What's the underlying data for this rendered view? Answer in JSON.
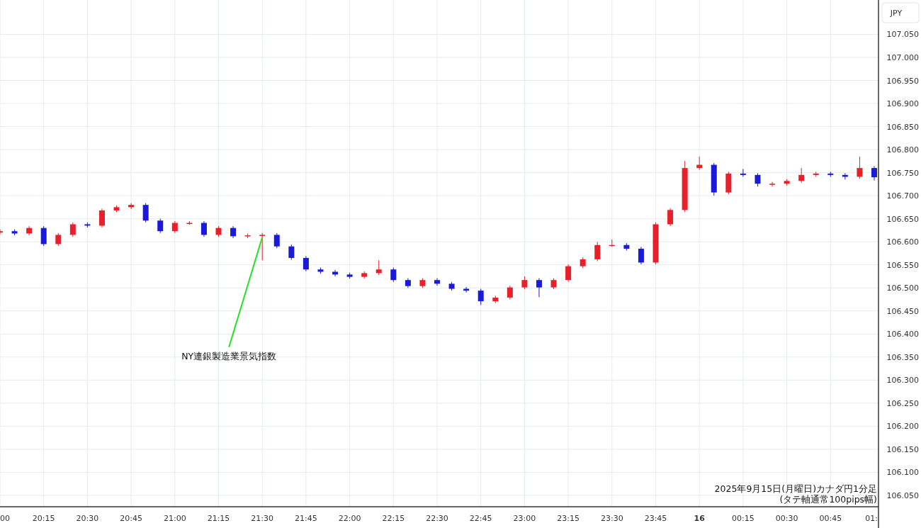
{
  "chart": {
    "unit": "JPY",
    "edge_label": "01:",
    "caption": [
      "2025年9月15日(月曜日)カナダ円1分足",
      "(タテ軸通常100pips幅)"
    ],
    "chart_data": {
      "type": "candlestick",
      "categories": [
        "00",
        null,
        null,
        "20:15",
        null,
        null,
        "20:30",
        null,
        null,
        "20:45",
        null,
        null,
        "21:00",
        null,
        null,
        "21:15",
        null,
        null,
        "21:30",
        null,
        null,
        "21:45",
        null,
        null,
        "22:00",
        null,
        null,
        "22:15",
        null,
        null,
        "22:30",
        null,
        null,
        "22:45",
        null,
        null,
        "23:00",
        null,
        null,
        "23:15",
        null,
        null,
        "23:30",
        null,
        null,
        "23:45",
        null,
        null,
        "16",
        null,
        null,
        "00:15",
        null,
        null,
        "00:30",
        null,
        null,
        "00:45",
        null,
        null,
        null
      ],
      "ohlc": [
        [
          106.62,
          106.627,
          106.616,
          106.623
        ],
        [
          106.623,
          106.627,
          106.614,
          106.618
        ],
        [
          106.618,
          106.634,
          106.614,
          106.63
        ],
        [
          106.63,
          106.634,
          106.591,
          106.595
        ],
        [
          106.595,
          106.619,
          106.591,
          106.615
        ],
        [
          106.615,
          106.642,
          106.611,
          106.638
        ],
        [
          106.638,
          106.642,
          106.631,
          106.635
        ],
        [
          106.635,
          106.672,
          106.631,
          106.668
        ],
        [
          106.668,
          106.679,
          106.664,
          106.675
        ],
        [
          106.675,
          106.684,
          106.671,
          106.68
        ],
        [
          106.68,
          106.684,
          106.642,
          106.646
        ],
        [
          106.646,
          106.65,
          106.619,
          106.623
        ],
        [
          106.623,
          106.645,
          106.619,
          106.641
        ],
        [
          106.641,
          106.645,
          106.637,
          106.641
        ],
        [
          106.641,
          106.645,
          106.611,
          106.615
        ],
        [
          106.615,
          106.634,
          106.611,
          106.63
        ],
        [
          106.63,
          106.634,
          106.608,
          106.612
        ],
        [
          106.612,
          106.618,
          106.608,
          106.614
        ],
        [
          106.614,
          106.619,
          106.56,
          106.615
        ],
        [
          106.615,
          106.619,
          106.586,
          106.59
        ],
        [
          106.59,
          106.594,
          106.561,
          106.565
        ],
        [
          106.565,
          106.569,
          106.536,
          106.54
        ],
        [
          106.54,
          106.544,
          106.531,
          106.535
        ],
        [
          106.535,
          106.539,
          106.525,
          106.529
        ],
        [
          106.529,
          106.533,
          106.52,
          106.524
        ],
        [
          106.524,
          106.536,
          106.52,
          106.532
        ],
        [
          106.532,
          106.56,
          106.528,
          106.54
        ],
        [
          106.54,
          106.544,
          106.513,
          106.517
        ],
        [
          106.517,
          106.521,
          106.5,
          106.504
        ],
        [
          106.504,
          106.521,
          106.5,
          106.517
        ],
        [
          106.517,
          106.521,
          106.505,
          106.509
        ],
        [
          106.509,
          106.513,
          106.494,
          106.498
        ],
        [
          106.498,
          106.502,
          106.49,
          106.494
        ],
        [
          106.494,
          106.498,
          106.463,
          106.471
        ],
        [
          106.471,
          106.483,
          106.467,
          106.479
        ],
        [
          106.479,
          106.505,
          106.475,
          106.501
        ],
        [
          106.501,
          106.525,
          106.497,
          106.517
        ],
        [
          106.517,
          106.521,
          106.48,
          106.501
        ],
        [
          106.501,
          106.521,
          106.497,
          106.517
        ],
        [
          106.517,
          106.551,
          106.513,
          106.547
        ],
        [
          106.547,
          106.566,
          106.543,
          106.562
        ],
        [
          106.562,
          106.6,
          106.558,
          106.593
        ],
        [
          106.593,
          106.605,
          106.589,
          106.593
        ],
        [
          106.593,
          106.597,
          106.581,
          106.585
        ],
        [
          106.585,
          106.589,
          106.551,
          106.555
        ],
        [
          106.555,
          106.642,
          106.551,
          106.638
        ],
        [
          106.638,
          106.673,
          106.634,
          106.669
        ],
        [
          106.669,
          106.775,
          106.665,
          106.76
        ],
        [
          106.76,
          106.785,
          106.756,
          106.767
        ],
        [
          106.767,
          106.771,
          106.7,
          106.707
        ],
        [
          106.707,
          106.752,
          106.703,
          106.748
        ],
        [
          106.748,
          106.758,
          106.741,
          106.745
        ],
        [
          106.745,
          106.749,
          106.72,
          106.726
        ],
        [
          106.726,
          106.73,
          106.72,
          106.726
        ],
        [
          106.726,
          106.736,
          106.722,
          106.732
        ],
        [
          106.732,
          106.76,
          106.728,
          106.745
        ],
        [
          106.745,
          106.752,
          106.741,
          106.748
        ],
        [
          106.748,
          106.752,
          106.741,
          106.745
        ],
        [
          106.745,
          106.749,
          106.735,
          106.741
        ],
        [
          106.741,
          106.785,
          106.737,
          106.76
        ],
        [
          106.76,
          106.764,
          106.733,
          106.74
        ]
      ],
      "ylim": [
        106.0253,
        107.1245
      ],
      "grid": true,
      "yticks": [
        {
          "value": 106.05,
          "label": "106.050"
        },
        {
          "value": 106.1,
          "label": "106.100"
        },
        {
          "value": 106.15,
          "label": "106.150"
        },
        {
          "value": 106.2,
          "label": "106.200"
        },
        {
          "value": 106.25,
          "label": "106.250"
        },
        {
          "value": 106.3,
          "label": "106.300"
        },
        {
          "value": 106.35,
          "label": "106.350"
        },
        {
          "value": 106.4,
          "label": "106.400"
        },
        {
          "value": 106.45,
          "label": "106.450"
        },
        {
          "value": 106.5,
          "label": "106.500"
        },
        {
          "value": 106.55,
          "label": "106.550"
        },
        {
          "value": 106.6,
          "label": "106.600"
        },
        {
          "value": 106.65,
          "label": "106.650"
        },
        {
          "value": 106.7,
          "label": "106.700"
        },
        {
          "value": 106.75,
          "label": "106.750"
        },
        {
          "value": 106.8,
          "label": "106.800"
        },
        {
          "value": 106.85,
          "label": "106.850"
        },
        {
          "value": 106.9,
          "label": "106.900"
        },
        {
          "value": 106.95,
          "label": "106.950"
        },
        {
          "value": 107.0,
          "label": "107.000"
        },
        {
          "value": 107.05,
          "label": "107.050"
        }
      ],
      "annotations": [
        {
          "text": "NY連銀製造業景気指数",
          "x": "21:30",
          "y": 106.61
        }
      ]
    }
  }
}
